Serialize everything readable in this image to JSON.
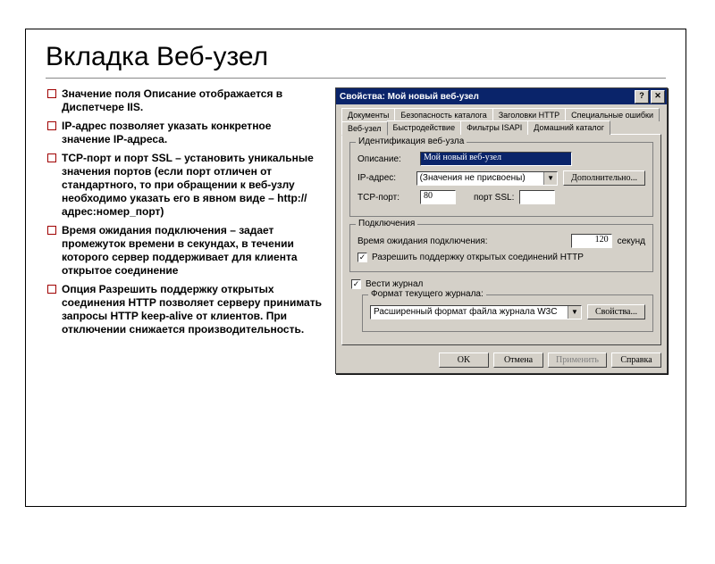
{
  "slide": {
    "title": "Вкладка Веб-узел",
    "bullets": [
      "Значение поля Описание отображается в Диспетчере IIS.",
      "IP-адрес позволяет указать конкретное значение IP-адреса.",
      "TCP-порт и порт SSL – установить уникальные значения портов (если порт отличен от стандартного, то при обращении к веб-узлу необходимо указать его в явном виде – http://адрес:номер_порт)",
      "Время ожидания подключения – задает промежуток времени в секундах, в течении которого сервер поддерживает для клиента открытое соединение",
      "Опция Разрешить поддержку открытых соединения HTTP позволяет серверу принимать запросы HTTP keep-alive от клиентов. При отключении снижается производительность."
    ]
  },
  "dialog": {
    "title": "Свойства: Мой новый веб-узел",
    "tabs_row1": [
      "Документы",
      "Безопасность каталога",
      "Заголовки HTTP",
      "Специальные ошибки"
    ],
    "tabs_row2": [
      "Веб-узел",
      "Быстродействие",
      "Фильтры ISAPI",
      "Домашний каталог"
    ],
    "group_ident": {
      "title": "Идентификация веб-узла",
      "desc_label": "Описание:",
      "desc_value": "Мой новый веб-узел",
      "ip_label": "IP-адрес:",
      "ip_value": "(Значения не присвоены)",
      "tcp_label": "TCP-порт:",
      "tcp_value": "80",
      "ssl_label": "порт SSL:",
      "advanced_btn": "Дополнительно..."
    },
    "group_conn": {
      "title": "Подключения",
      "timeout_label": "Время ожидания подключения:",
      "timeout_value": "120",
      "timeout_unit": "секунд",
      "keepalive_label": "Разрешить поддержку открытых соединений HTTP"
    },
    "log_checkbox": "Вести журнал",
    "group_log": {
      "title": "Формат текущего журнала:",
      "format_value": "Расширенный формат файла журнала W3C",
      "props_btn": "Свойства..."
    },
    "buttons": {
      "ok": "OK",
      "cancel": "Отмена",
      "apply": "Применить",
      "help": "Справка"
    }
  }
}
